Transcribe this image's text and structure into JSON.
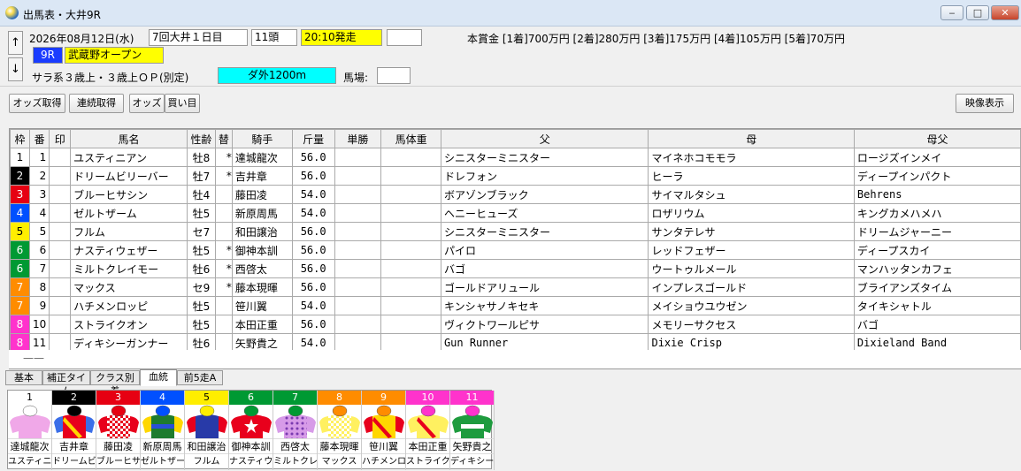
{
  "window": {
    "title": "出馬表・大井9R",
    "min": "‒",
    "max": "□",
    "close": "✕"
  },
  "header": {
    "up": "↑",
    "down": "↓",
    "date": "2026年08月12日(水)",
    "meeting": "7回大井１日目",
    "heads": "11頭",
    "post_time": "20:10発走",
    "race_no": "9R",
    "race_name": "武蔵野オープン",
    "conditions": "サラ系３歳上・３歳上ＯＰ(別定)",
    "course": "ダ外1200m",
    "baba_label": "馬場:",
    "prize": "本賞金 [1着]700万円 [2着]280万円 [3着]175万円 [4着]105万円 [5着]70万円"
  },
  "toolbar": {
    "odds": "オッズ取得",
    "renpuku": "連続取得",
    "odds2": "オッズ",
    "kaime": "買い目",
    "video": "映像表示"
  },
  "columns": [
    "枠",
    "番",
    "印",
    "馬名",
    "性齢",
    "替",
    "騎手",
    "斤量",
    "単勝",
    "馬体重",
    "父",
    "母",
    "母父"
  ],
  "frame_colors": {
    "1": "#ffffff",
    "2": "#000000",
    "3": "#e60012",
    "4": "#0050ff",
    "5": "#ffee00",
    "6": "#009933",
    "7": "#ff8c00",
    "8": "#ff33cc"
  },
  "frame_text": {
    "1": "#000000",
    "2": "#ffffff",
    "3": "#ffffff",
    "4": "#ffffff",
    "5": "#000000",
    "6": "#ffffff",
    "7": "#ffffff",
    "8": "#ffffff"
  },
  "rows": [
    {
      "waku": "1",
      "ban": "1",
      "mark": "",
      "name": "ユスティニアン",
      "sexage": "牡8",
      "kae": "*",
      "jockey": "達城龍次",
      "weight": "56.0",
      "odds": "",
      "bw": "",
      "sire": "シニスターミニスター",
      "dam": "マイネホコモモラ",
      "bms": "ロージズインメイ"
    },
    {
      "waku": "2",
      "ban": "2",
      "mark": "",
      "name": "ドリームビリーバー",
      "sexage": "牡7",
      "kae": "*",
      "jockey": "吉井章",
      "weight": "56.0",
      "odds": "",
      "bw": "",
      "sire": "ドレフォン",
      "dam": "ヒーラ",
      "bms": "ディープインパクト"
    },
    {
      "waku": "3",
      "ban": "3",
      "mark": "",
      "name": "ブルーヒサシン",
      "sexage": "牡4",
      "kae": "",
      "jockey": "藤田凌",
      "weight": "54.0",
      "odds": "",
      "bw": "",
      "sire": "ボアゾンブラック",
      "dam": "サイマルタシュ",
      "bms": "Behrens"
    },
    {
      "waku": "4",
      "ban": "4",
      "mark": "",
      "name": "ゼルトザーム",
      "sexage": "牡5",
      "kae": "",
      "jockey": "新原周馬",
      "weight": "54.0",
      "odds": "",
      "bw": "",
      "sire": "ヘニーヒューズ",
      "dam": "ロザリウム",
      "bms": "キングカメハメハ"
    },
    {
      "waku": "5",
      "ban": "5",
      "mark": "",
      "name": "フルム",
      "sexage": "セ7",
      "kae": "",
      "jockey": "和田譲治",
      "weight": "56.0",
      "odds": "",
      "bw": "",
      "sire": "シニスターミニスター",
      "dam": "サンタテレサ",
      "bms": "ドリームジャーニー"
    },
    {
      "waku": "6",
      "ban": "6",
      "mark": "",
      "name": "ナスティウェザー",
      "sexage": "牡5",
      "kae": "*",
      "jockey": "御神本訓",
      "weight": "56.0",
      "odds": "",
      "bw": "",
      "sire": "パイロ",
      "dam": "レッドフェザー",
      "bms": "ディープスカイ"
    },
    {
      "waku": "6",
      "ban": "7",
      "mark": "",
      "name": "ミルトクレイモー",
      "sexage": "牡6",
      "kae": "*",
      "jockey": "西啓太",
      "weight": "56.0",
      "odds": "",
      "bw": "",
      "sire": "バゴ",
      "dam": "ウートゥルメール",
      "bms": "マンハッタンカフェ"
    },
    {
      "waku": "7",
      "ban": "8",
      "mark": "",
      "name": "マックス",
      "sexage": "セ9",
      "kae": "*",
      "jockey": "藤本現暉",
      "weight": "56.0",
      "odds": "",
      "bw": "",
      "sire": "ゴールドアリュール",
      "dam": "インプレスゴールド",
      "bms": "ブライアンズタイム"
    },
    {
      "waku": "7",
      "ban": "9",
      "mark": "",
      "name": "ハチメンロッピ",
      "sexage": "牡5",
      "kae": "",
      "jockey": "笹川翼",
      "weight": "54.0",
      "odds": "",
      "bw": "",
      "sire": "キンシャサノキセキ",
      "dam": "メイショウユウゼン",
      "bms": "タイキシャトル"
    },
    {
      "waku": "8",
      "ban": "10",
      "mark": "",
      "name": "ストライクオン",
      "sexage": "牡5",
      "kae": "",
      "jockey": "本田正重",
      "weight": "56.0",
      "odds": "",
      "bw": "",
      "sire": "ヴィクトワールピサ",
      "dam": "メモリーサクセス",
      "bms": "バゴ"
    },
    {
      "waku": "8",
      "ban": "11",
      "mark": "",
      "name": "ディキシーガンナー",
      "sexage": "牡6",
      "kae": "",
      "jockey": "矢野貴之",
      "weight": "54.0",
      "odds": "",
      "bw": "",
      "sire": "Gun Runner",
      "dam": "Dixie Crisp",
      "bms": "Dixieland Band"
    }
  ],
  "dash": "——",
  "tabs": [
    "基本",
    "補正タイム",
    "クラス別着",
    "血統",
    "前5走A"
  ],
  "active_tab": "血統",
  "silks": [
    {
      "no": "1",
      "jockey": "達城龍次",
      "horse": "ユスティニ",
      "cap": "#ffffff",
      "body": "#f0a8e8",
      "sleeve": "#f0a8e8",
      "pattern": "plain",
      "accent": "#f0a8e8"
    },
    {
      "no": "2",
      "jockey": "吉井章",
      "horse": "ドリームビ",
      "cap": "#000000",
      "body": "#e8001c",
      "sleeve": "#3a6ee8",
      "pattern": "sash",
      "accent": "#ffd700"
    },
    {
      "no": "3",
      "jockey": "藤田凌",
      "horse": "ブルーヒサ",
      "cap": "#e60012",
      "body": "#e8001c",
      "sleeve": "#e8001c",
      "pattern": "check",
      "accent": "#ffffff"
    },
    {
      "no": "4",
      "jockey": "新原周馬",
      "horse": "ゼルトザー",
      "cap": "#0050ff",
      "body": "#1e7b2e",
      "sleeve": "#ffd700",
      "pattern": "band",
      "accent": "#2a4ed8"
    },
    {
      "no": "5",
      "jockey": "和田譲治",
      "horse": "フルム",
      "cap": "#ffee00",
      "body": "#283aa8",
      "sleeve": "#e8001c",
      "pattern": "plain",
      "accent": "#e8001c"
    },
    {
      "no": "6",
      "jockey": "御神本訓",
      "horse": "ナスティウ",
      "cap": "#009933",
      "body": "#e8001c",
      "sleeve": "#e8001c",
      "pattern": "star",
      "accent": "#ffffff"
    },
    {
      "no": "7",
      "jockey": "西啓太",
      "horse": "ミルトクレ",
      "cap": "#009933",
      "body": "#d79be8",
      "sleeve": "#d79be8",
      "pattern": "dots",
      "accent": "#7a3ab0"
    },
    {
      "no": "8",
      "jockey": "藤本現暉",
      "horse": "マックス",
      "cap": "#ff8c00",
      "body": "#fff060",
      "sleeve": "#fff060",
      "pattern": "check",
      "accent": "#ffffff"
    },
    {
      "no": "9",
      "jockey": "笹川翼",
      "horse": "ハチメンロ",
      "cap": "#ff8c00",
      "body": "#ffd700",
      "sleeve": "#e8001c",
      "pattern": "sash",
      "accent": "#e8001c"
    },
    {
      "no": "10",
      "jockey": "本田正重",
      "horse": "ストライク",
      "cap": "#ff33cc",
      "body": "#fff060",
      "sleeve": "#fff060",
      "pattern": "sash",
      "accent": "#e8001c"
    },
    {
      "no": "11",
      "jockey": "矢野貴之",
      "horse": "ディキシー",
      "cap": "#ff33cc",
      "body": "#1e9b3e",
      "sleeve": "#1e9b3e",
      "pattern": "band",
      "accent": "#ffffff"
    }
  ]
}
